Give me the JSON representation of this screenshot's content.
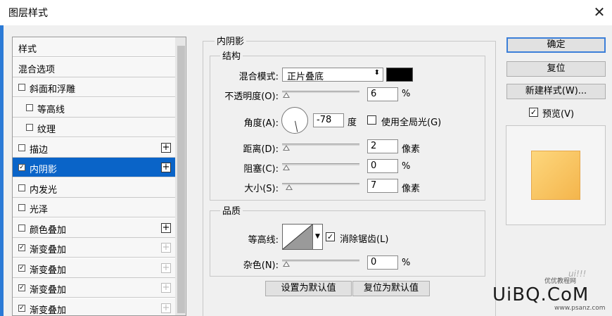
{
  "window": {
    "title": "图层样式"
  },
  "style_list": {
    "items": [
      {
        "label": "样式",
        "checkbox": false,
        "plus": "none"
      },
      {
        "label": "混合选项",
        "checkbox": false,
        "plus": "none"
      },
      {
        "label": "斜面和浮雕",
        "checkbox": true,
        "checked": false,
        "plus": "none"
      },
      {
        "label": "等高线",
        "checkbox": true,
        "checked": false,
        "plus": "none",
        "indent": true
      },
      {
        "label": "纹理",
        "checkbox": true,
        "checked": false,
        "plus": "none",
        "indent": true
      },
      {
        "label": "描边",
        "checkbox": true,
        "checked": false,
        "plus": "active"
      },
      {
        "label": "内阴影",
        "checkbox": true,
        "checked": true,
        "plus": "active",
        "selected": true
      },
      {
        "label": "内发光",
        "checkbox": true,
        "checked": false,
        "plus": "none"
      },
      {
        "label": "光泽",
        "checkbox": true,
        "checked": false,
        "plus": "none"
      },
      {
        "label": "颜色叠加",
        "checkbox": true,
        "checked": false,
        "plus": "active"
      },
      {
        "label": "渐变叠加",
        "checkbox": true,
        "checked": true,
        "plus": "dim"
      },
      {
        "label": "渐变叠加",
        "checkbox": true,
        "checked": true,
        "plus": "dim"
      },
      {
        "label": "渐变叠加",
        "checkbox": true,
        "checked": true,
        "plus": "dim"
      },
      {
        "label": "渐变叠加",
        "checkbox": true,
        "checked": true,
        "plus": "dim"
      }
    ],
    "plus_glyph": "+",
    "check_glyph": "✓"
  },
  "inner_shadow": {
    "section_title": "内阴影",
    "structure": {
      "legend": "结构",
      "blend_mode_label": "混合模式:",
      "blend_mode_value": "正片叠底",
      "blend_color": "#000000",
      "opacity_label": "不透明度(O):",
      "opacity_value": "6",
      "opacity_unit": "%",
      "angle_label": "角度(A):",
      "angle_value": "-78",
      "angle_unit": "度",
      "global_light_label": "使用全局光(G)",
      "global_light_checked": false,
      "distance_label": "距离(D):",
      "distance_value": "2",
      "distance_unit": "像素",
      "choke_label": "阻塞(C):",
      "choke_value": "0",
      "choke_unit": "%",
      "size_label": "大小(S):",
      "size_value": "7",
      "size_unit": "像素"
    },
    "quality": {
      "legend": "品质",
      "contour_label": "等高线:",
      "anti_alias_label": "消除锯齿(L)",
      "anti_alias_checked": true,
      "noise_label": "杂色(N):",
      "noise_value": "0",
      "noise_unit": "%"
    },
    "make_default_label": "设置为默认值",
    "reset_default_label": "复位为默认值"
  },
  "buttons": {
    "ok": "确定",
    "reset": "复位",
    "new_style": "新建样式(W)...",
    "preview_label": "预览(V)",
    "preview_checked": true
  },
  "preview": {
    "fill_top": "#fdd77d",
    "fill_bottom": "#f4b54c"
  },
  "watermark": {
    "text": "UiBQ.CoM",
    "small": "优优教程网",
    "url": "www.psanz.com"
  }
}
